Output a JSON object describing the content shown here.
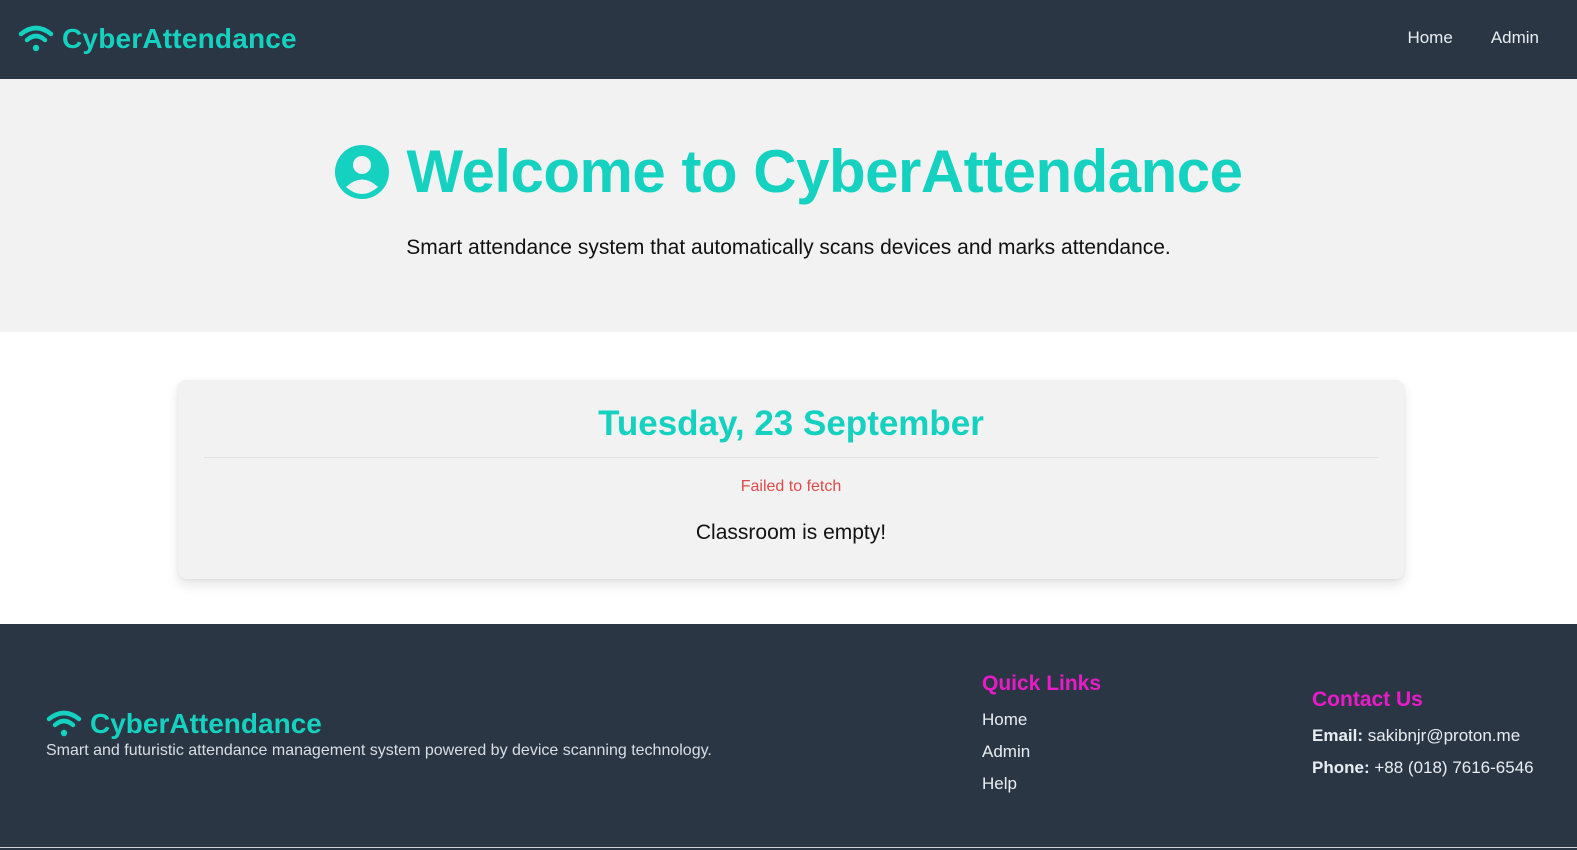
{
  "header": {
    "brand": "CyberAttendance",
    "nav": [
      {
        "label": "Home"
      },
      {
        "label": "Admin"
      }
    ]
  },
  "hero": {
    "title": "Welcome to CyberAttendance",
    "subtitle": "Smart attendance system that automatically scans devices and marks attendance."
  },
  "card": {
    "date": "Tuesday, 23 September",
    "error": "Failed to fetch",
    "empty_message": "Classroom is empty!"
  },
  "footer": {
    "brand": "CyberAttendance",
    "description": "Smart and futuristic attendance management system powered by device scanning technology.",
    "quick_links": {
      "title": "Quick Links",
      "items": [
        {
          "label": "Home"
        },
        {
          "label": "Admin"
        },
        {
          "label": "Help"
        }
      ]
    },
    "contact": {
      "title": "Contact Us",
      "email_label": "Email:",
      "email": "sakibnjr@proton.me",
      "phone_label": "Phone:",
      "phone": "+88 (018) 7616-6546"
    }
  },
  "icons": {
    "brand": "wifi-icon",
    "hero": "user-circle-icon"
  },
  "colors": {
    "accent": "#14d1c0",
    "dark": "#2b3644",
    "light_bg": "#f2f2f2",
    "error": "#e04b4b",
    "footer_heading": "#e81bc8"
  }
}
